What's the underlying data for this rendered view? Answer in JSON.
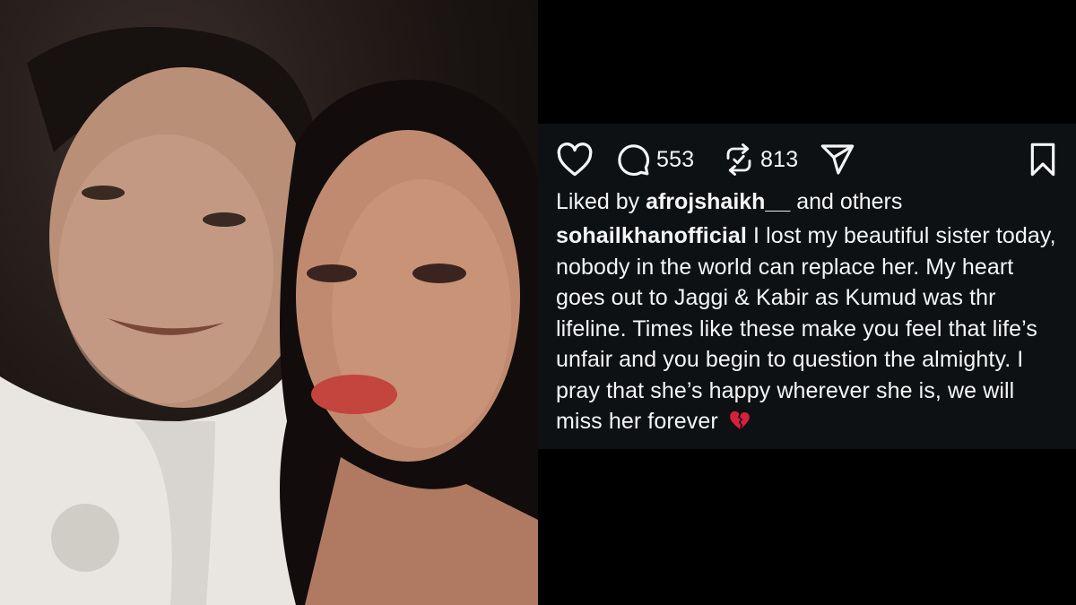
{
  "photo": {
    "alt": ""
  },
  "post": {
    "actions": {
      "comment_count": "553",
      "repost_count": "813"
    },
    "liked_by": {
      "prefix": "Liked by ",
      "user": "afrojshaikh__",
      "suffix": " and others"
    },
    "caption": {
      "username": "sohailkhanofficial",
      "text": " I lost my beautiful sister today, nobody in the world can replace her. My heart goes out to Jaggi & Kabir as Kumud was thr lifeline. Times like these make you feel that life’s unfair and you begin to question the almighty. I pray that she’s happy wherever she is, we will miss her forever"
    },
    "colors": {
      "background": "#0e1114",
      "text": "#f5f5f5",
      "heart_emoji": "#d4213d"
    },
    "icons": [
      "heart-icon",
      "comment-icon",
      "repost-icon",
      "share-icon",
      "bookmark-icon",
      "broken-heart-icon"
    ]
  }
}
